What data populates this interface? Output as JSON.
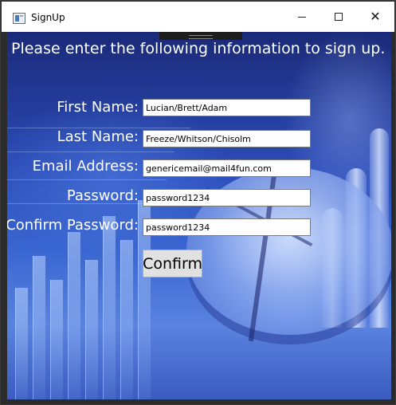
{
  "window": {
    "title": "SignUp",
    "minimize_label": "",
    "maximize_label": "",
    "close_label": "✕"
  },
  "form": {
    "instructions": "Please enter the following information to sign up.",
    "first_name": {
      "label": "First Name:",
      "value": "Lucian/Brett/Adam"
    },
    "last_name": {
      "label": "Last Name:",
      "value": "Freeze/Whitson/Chisolm"
    },
    "email": {
      "label": "Email Address:",
      "value": "genericemail@mail4fun.com"
    },
    "password": {
      "label": "Password:",
      "value": "password1234"
    },
    "confirm_password": {
      "label": "Confirm Password:",
      "value": "password1234"
    },
    "confirm_button": "Confirm"
  },
  "colors": {
    "label_text": "#ffffff",
    "background_blue": "#2a49b4",
    "button_face": "#e1e1e1"
  },
  "icons": {
    "app": "window-app-icon",
    "minimize": "minimize-icon",
    "maximize": "maximize-icon",
    "close": "close-icon"
  }
}
